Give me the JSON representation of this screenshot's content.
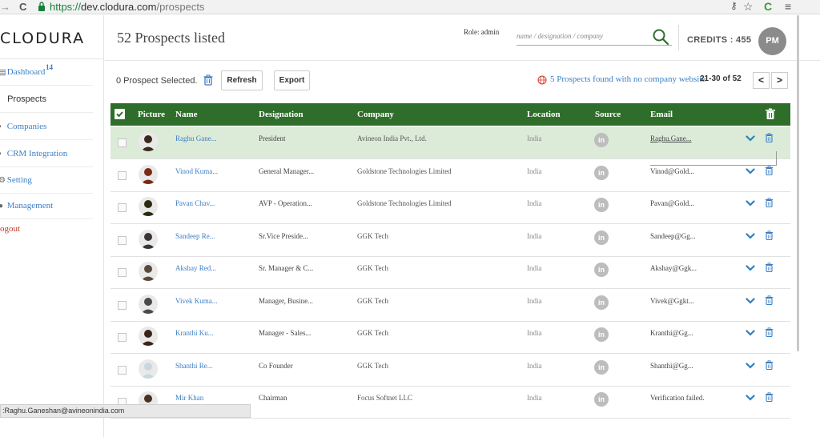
{
  "browser": {
    "url_scheme": "https://",
    "url_host": "dev.clodura.com",
    "url_path": "/prospects"
  },
  "sidebar": {
    "logo": "CLODURA",
    "items": [
      {
        "label": "Dashboard",
        "badge": "14",
        "icon": "dashboard-icon"
      },
      {
        "label": "Prospects",
        "icon": "prospects-icon"
      },
      {
        "label": "Companies",
        "icon": "companies-icon"
      },
      {
        "label": "CRM Integration",
        "icon": "crm-icon"
      },
      {
        "label": "Setting",
        "icon": "gear-icon"
      },
      {
        "label": "Management",
        "icon": "user-icon"
      },
      {
        "label": "ogout"
      }
    ]
  },
  "header": {
    "title": "52 Prospects listed",
    "role": "Role: admin",
    "search_placeholder": "name / designation / company",
    "credits": "CREDITS : 455",
    "avatar_initials": "PM"
  },
  "toolbar": {
    "selected": "0 Prospect Selected.",
    "refresh": "Refresh",
    "export": "Export",
    "no_company": "5 Prospects found with no company website",
    "range": "21-30 of 52",
    "prev": "<",
    "next": ">"
  },
  "table": {
    "columns": {
      "picture": "Picture",
      "name": "Name",
      "designation": "Designation",
      "company": "Company",
      "location": "Location",
      "source": "Source",
      "email": "Email"
    },
    "source_icon_text": "in",
    "rows": [
      {
        "name": "Raghu Gane...",
        "designation": "President",
        "company": "Avineon India Pvt., Ltd.",
        "location": "India",
        "email": "Raghu.Gane...",
        "highlighted": true,
        "avatar_color": "#3a2a1e"
      },
      {
        "name": "Vinod Kuma...",
        "designation": "General Manager...",
        "company": "Goldstone Technologies Limited",
        "location": "India",
        "email": "Vinod@Gold...",
        "avatar_color": "#7a2a14"
      },
      {
        "name": "Pavan Chav...",
        "designation": "AVP - Operation...",
        "company": "Goldstone Technologies Limited",
        "location": "India",
        "email": "Pavan@Gold...",
        "avatar_color": "#2c2a10"
      },
      {
        "name": "Sandeep Re...",
        "designation": "Sr.Vice Preside...",
        "company": "GGK Tech",
        "location": "India",
        "email": "Sandeep@Gg...",
        "avatar_color": "#3a3532"
      },
      {
        "name": "Akshay Red...",
        "designation": "Sr. Manager & C...",
        "company": "GGK Tech",
        "location": "India",
        "email": "Akshay@Ggk...",
        "avatar_color": "#5a4a3a"
      },
      {
        "name": "Vivek Kuma...",
        "designation": "Manager, Busine...",
        "company": "GGK Tech",
        "location": "India",
        "email": "Vivek@Ggkt...",
        "avatar_color": "#4a4a4a"
      },
      {
        "name": "Kranthi Ku...",
        "designation": "Manager - Sales...",
        "company": "GGK Tech",
        "location": "India",
        "email": "Kranthi@Gg...",
        "avatar_color": "#3a2418"
      },
      {
        "name": "Shanthi Re...",
        "designation": "Co Founder",
        "company": "GGK Tech",
        "location": "India",
        "email": "Shanthi@Gg...",
        "avatar_color": "#c8d8e0"
      },
      {
        "name": "Mir Khan",
        "designation": "Chairman",
        "company": "Focus Softnet LLC",
        "location": "India",
        "email": "Verification failed.",
        "avatar_color": "#4a3020"
      }
    ]
  },
  "status_bar": ":Raghu.Ganeshan@avineonindia.com",
  "colors": {
    "header_green": "#2f6e2a",
    "row_highlight": "#dcebd8",
    "link_blue": "#3b7fc4",
    "logo_green": "#3a7a2a"
  }
}
